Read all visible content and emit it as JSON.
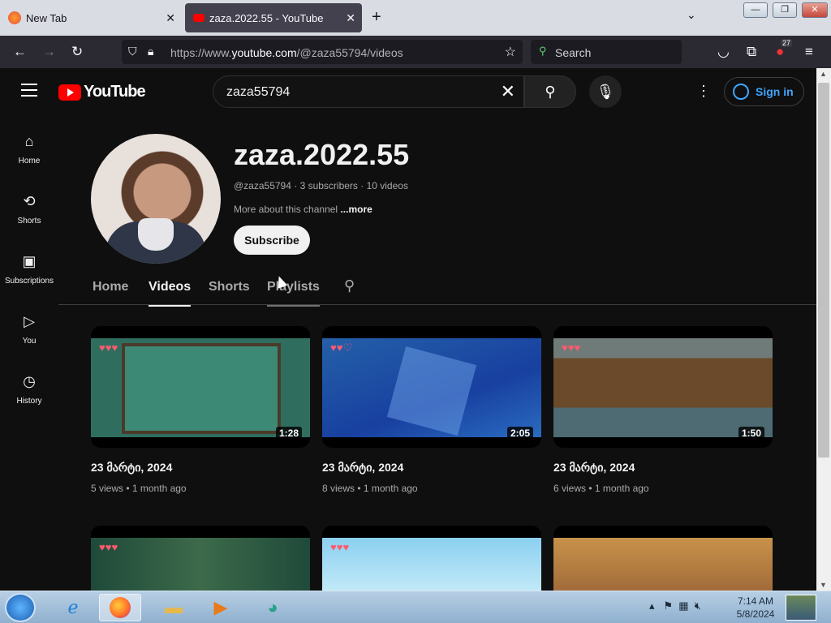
{
  "browser": {
    "tabs": [
      {
        "label": "New Tab",
        "active": false
      },
      {
        "label": "zaza.2022.55 - YouTube",
        "active": true
      }
    ],
    "url_prefix": "https://www.",
    "url_domain": "youtube.com",
    "url_path": "/@zaza55794/videos",
    "search_placeholder": "Search",
    "extension_badge": "27"
  },
  "youtube": {
    "logo_text": "YouTube",
    "search_value": "zaza55794",
    "signin_label": "Sign in",
    "sidebar": [
      {
        "label": "Home",
        "icon": "home-icon"
      },
      {
        "label": "Shorts",
        "icon": "shorts-icon"
      },
      {
        "label": "Subscriptions",
        "icon": "subscriptions-icon"
      },
      {
        "label": "You",
        "icon": "you-icon"
      },
      {
        "label": "History",
        "icon": "history-icon"
      }
    ],
    "channel": {
      "name": "zaza.2022.55",
      "meta": "@zaza55794 · 3 subscribers · 10 videos",
      "about": "More about this channel",
      "more": "...more",
      "subscribe_label": "Subscribe"
    },
    "tabs": [
      "Home",
      "Videos",
      "Shorts",
      "Playlists"
    ],
    "videos": [
      {
        "title": "23 მარტი, 2024",
        "meta": "5 views • 1 month ago",
        "duration": "1:28",
        "scene": "green"
      },
      {
        "title": "23 მარტი, 2024",
        "meta": "8 views • 1 month ago",
        "duration": "2:05",
        "scene": "blue"
      },
      {
        "title": "23 მარტი, 2024",
        "meta": "6 views • 1 month ago",
        "duration": "1:50",
        "scene": "cave"
      },
      {
        "title": "",
        "meta": "",
        "duration": "",
        "scene": "forest"
      },
      {
        "title": "",
        "meta": "",
        "duration": "",
        "scene": "sky"
      },
      {
        "title": "",
        "meta": "",
        "duration": "",
        "scene": "desert"
      }
    ]
  },
  "taskbar": {
    "time": "7:14 AM",
    "date": "5/8/2024"
  },
  "colors": {
    "yt_red": "#ff0000",
    "link_blue": "#3ea6ff",
    "background": "#0f0f0f"
  }
}
